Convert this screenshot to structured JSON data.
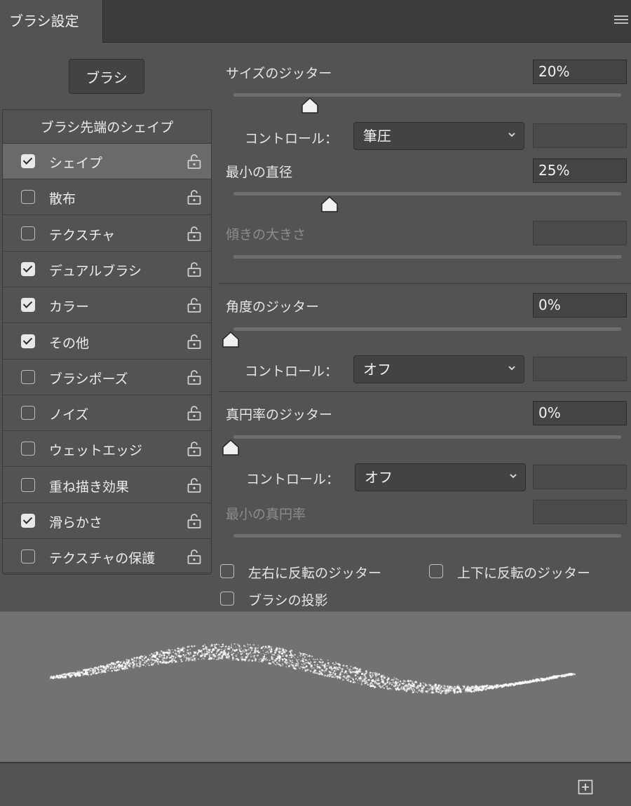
{
  "tab": {
    "title": "ブラシ設定"
  },
  "brush_button": {
    "label": "ブラシ"
  },
  "left_panel": {
    "header": "ブラシ先端のシェイプ",
    "items": [
      {
        "label": "シェイプ",
        "checked": true,
        "selected": true
      },
      {
        "label": "散布",
        "checked": false
      },
      {
        "label": "テクスチャ",
        "checked": false
      },
      {
        "label": "デュアルブラシ",
        "checked": true
      },
      {
        "label": "カラー",
        "checked": true
      },
      {
        "label": "その他",
        "checked": true
      },
      {
        "label": "ブラシポーズ",
        "checked": false
      },
      {
        "label": "ノイズ",
        "checked": false
      },
      {
        "label": "ウェットエッジ",
        "checked": false
      },
      {
        "label": "重ね描き効果",
        "checked": false
      },
      {
        "label": "滑らかさ",
        "checked": true
      },
      {
        "label": "テクスチャの保護",
        "checked": false
      }
    ]
  },
  "settings": {
    "size_jitter": {
      "label": "サイズのジッター",
      "value": "20%",
      "slider": 0.2
    },
    "size_control": {
      "label": "コントロール：",
      "value": "筆圧"
    },
    "min_diameter": {
      "label": "最小の直径",
      "value": "25%",
      "slider": 0.25
    },
    "tilt_scale": {
      "label": "傾きの大きさ"
    },
    "angle_jitter": {
      "label": "角度のジッター",
      "value": "0%",
      "slider": 0
    },
    "angle_control": {
      "label": "コントロール：",
      "value": "オフ"
    },
    "roundness_jitter": {
      "label": "真円率のジッター",
      "value": "0%",
      "slider": 0
    },
    "roundness_control": {
      "label": "コントロール：",
      "value": "オフ"
    },
    "min_roundness": {
      "label": "最小の真円率"
    },
    "flip_x": {
      "label": "左右に反転のジッター",
      "checked": false
    },
    "flip_y": {
      "label": "上下に反転のジッター",
      "checked": false
    },
    "brush_projection": {
      "label": "ブラシの投影",
      "checked": false
    }
  },
  "icons": {
    "panel_menu": "hamburger-icon",
    "lock": "unlock-icon",
    "chevron": "chevron-down-icon",
    "new_brush": "plus-square-icon"
  },
  "colors": {
    "panel_bg": "#535353",
    "tab_bar": "#3c3c3c",
    "selected_row": "#6a6a6a",
    "preview_bg": "#727272"
  }
}
